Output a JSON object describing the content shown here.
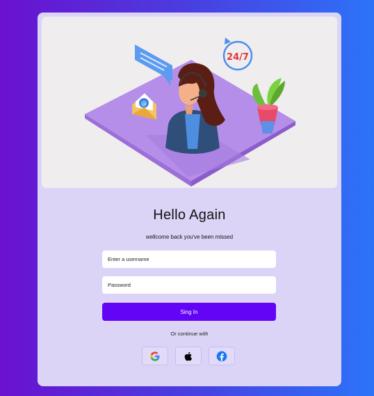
{
  "login": {
    "title": "Hello Again",
    "subtitle": "wellcome back you've been missed",
    "username_placeholder": "Enter a username",
    "password_placeholder": "Password",
    "signin_label": "Sing In",
    "continue_text": "Or continue with",
    "hero_badge": "24/7"
  },
  "colors": {
    "accent": "#6304f7",
    "card": "#dcd4f7",
    "hero_bg": "#efeded"
  },
  "social_icons": [
    "google-icon",
    "apple-icon",
    "facebook-icon"
  ]
}
